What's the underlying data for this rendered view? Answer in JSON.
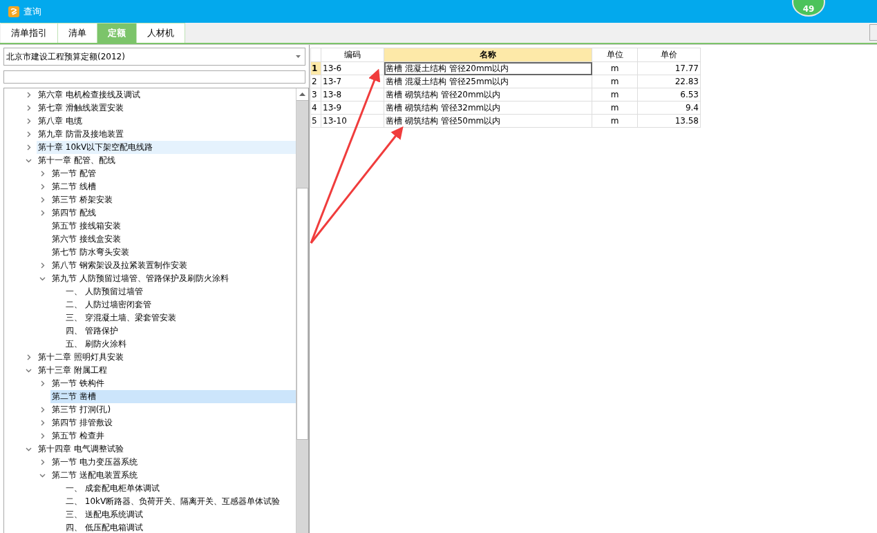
{
  "window": {
    "title": "查询",
    "badge": "49"
  },
  "tabs": [
    {
      "label": "清单指引",
      "selected": false
    },
    {
      "label": "清单",
      "selected": false
    },
    {
      "label": "定额",
      "selected": true
    },
    {
      "label": "人材机",
      "selected": false
    }
  ],
  "library_select": {
    "value": "北京市建设工程预算定额(2012)"
  },
  "tree": [
    {
      "label": "第六章 电机检查接线及调试",
      "expanded": false,
      "selected": false,
      "hovered": false
    },
    {
      "label": "第七章 滑触线装置安装",
      "expanded": false,
      "selected": false,
      "hovered": false
    },
    {
      "label": "第八章 电缆",
      "expanded": false,
      "selected": false,
      "hovered": false
    },
    {
      "label": "第九章 防雷及接地装置",
      "expanded": false,
      "selected": false,
      "hovered": false
    },
    {
      "label": "第十章 10kV以下架空配电线路",
      "expanded": false,
      "selected": false,
      "hovered": true
    },
    {
      "label": "第十一章 配管、配线",
      "expanded": true,
      "selected": false,
      "hovered": false,
      "children": [
        {
          "label": "第一节 配管",
          "expanded": false,
          "selected": false,
          "hovered": false
        },
        {
          "label": "第二节 线槽",
          "expanded": false,
          "selected": false,
          "hovered": false
        },
        {
          "label": "第三节 桥架安装",
          "expanded": false,
          "selected": false,
          "hovered": false
        },
        {
          "label": "第四节 配线",
          "expanded": false,
          "selected": false,
          "hovered": false
        },
        {
          "label": "第五节 接线箱安装",
          "kind": "leaf",
          "selected": false,
          "hovered": false
        },
        {
          "label": "第六节 接线盒安装",
          "kind": "leaf",
          "selected": false,
          "hovered": false
        },
        {
          "label": "第七节 防水弯头安装",
          "kind": "leaf",
          "selected": false,
          "hovered": false
        },
        {
          "label": "第八节 钢索架设及拉紧装置制作安装",
          "expanded": false,
          "selected": false,
          "hovered": false
        },
        {
          "label": "第九节 人防预留过墙管、管路保护及刷防火涂料",
          "expanded": true,
          "selected": false,
          "hovered": false,
          "children": [
            {
              "label": "一、 人防预留过墙管",
              "kind": "leaf",
              "selected": false,
              "hovered": false
            },
            {
              "label": "二、 人防过墙密闭套管",
              "kind": "leaf",
              "selected": false,
              "hovered": false
            },
            {
              "label": "三、 穿混凝土墙、梁套管安装",
              "kind": "leaf",
              "selected": false,
              "hovered": false
            },
            {
              "label": "四、 管路保护",
              "kind": "leaf",
              "selected": false,
              "hovered": false
            },
            {
              "label": "五、 刷防火涂料",
              "kind": "leaf",
              "selected": false,
              "hovered": false
            }
          ]
        }
      ]
    },
    {
      "label": "第十二章 照明灯具安装",
      "expanded": false,
      "selected": false,
      "hovered": false
    },
    {
      "label": "第十三章 附属工程",
      "expanded": true,
      "selected": false,
      "hovered": false,
      "children": [
        {
          "label": "第一节 铁构件",
          "expanded": false,
          "selected": false,
          "hovered": false
        },
        {
          "label": "第二节 凿槽",
          "kind": "leaf",
          "selected": true,
          "hovered": false
        },
        {
          "label": "第三节 打洞(孔)",
          "expanded": false,
          "selected": false,
          "hovered": false
        },
        {
          "label": "第四节 排管敷设",
          "expanded": false,
          "selected": false,
          "hovered": false
        },
        {
          "label": "第五节 检查井",
          "expanded": false,
          "selected": false,
          "hovered": false
        }
      ]
    },
    {
      "label": "第十四章 电气调整试验",
      "expanded": true,
      "selected": false,
      "hovered": false,
      "children": [
        {
          "label": "第一节 电力变压器系统",
          "expanded": false,
          "selected": false,
          "hovered": false
        },
        {
          "label": "第二节 送配电装置系统",
          "expanded": true,
          "selected": false,
          "hovered": false,
          "children": [
            {
              "label": "一、 成套配电柜单体调试",
              "kind": "leaf",
              "selected": false,
              "hovered": false
            },
            {
              "label": "二、 10kV断路器、负荷开关、隔离开关、互感器单体试验",
              "kind": "leaf",
              "selected": false,
              "hovered": false
            },
            {
              "label": "三、 送配电系统调试",
              "kind": "leaf",
              "selected": false,
              "hovered": false
            },
            {
              "label": "四、 低压配电箱调试",
              "kind": "leaf",
              "selected": false,
              "hovered": false
            }
          ]
        }
      ]
    }
  ],
  "table": {
    "columns": [
      "编码",
      "名称",
      "单位",
      "单价"
    ],
    "rows": [
      {
        "index": "1",
        "code": "13-6",
        "name": "凿槽 混凝土结构 管径20mm以内",
        "unit": "m",
        "price": "17.77",
        "selected": true
      },
      {
        "index": "2",
        "code": "13-7",
        "name": "凿槽 混凝土结构 管径25mm以内",
        "unit": "m",
        "price": "22.83",
        "selected": false
      },
      {
        "index": "3",
        "code": "13-8",
        "name": "凿槽 砌筑结构 管径20mm以内",
        "unit": "m",
        "price": "6.53",
        "selected": false
      },
      {
        "index": "4",
        "code": "13-9",
        "name": "凿槽 砌筑结构 管径32mm以内",
        "unit": "m",
        "price": "9.4",
        "selected": false
      },
      {
        "index": "5",
        "code": "13-10",
        "name": "凿槽 砌筑结构 管径50mm以内",
        "unit": "m",
        "price": "13.58",
        "selected": false
      }
    ]
  }
}
